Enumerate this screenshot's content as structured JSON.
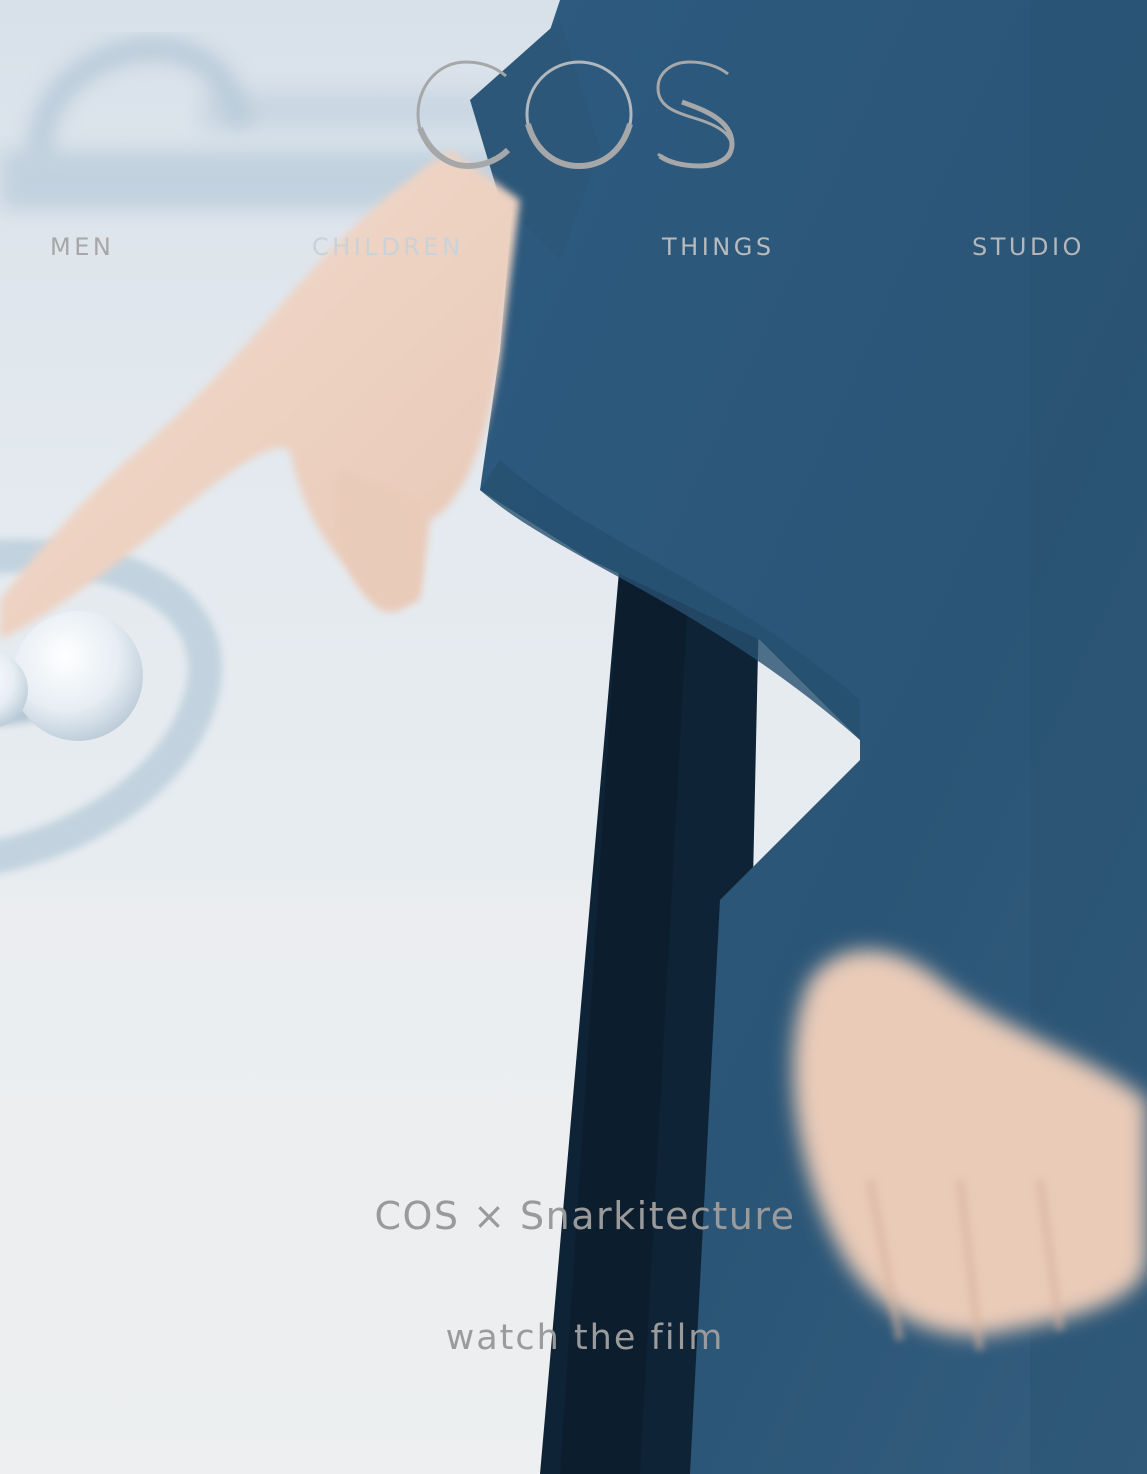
{
  "brand": {
    "logo_text": "COS"
  },
  "nav": {
    "items": [
      {
        "label": "MEN"
      },
      {
        "label": "CHILDREN"
      },
      {
        "label": "THINGS"
      },
      {
        "label": "STUDIO"
      }
    ]
  },
  "campaign": {
    "title": "COS × Snarkitecture",
    "cta": "watch the film"
  },
  "colors": {
    "background": "#dfe6ec",
    "garment_blue": "#2f5a7c",
    "text_grey": "#9a9a9b"
  }
}
